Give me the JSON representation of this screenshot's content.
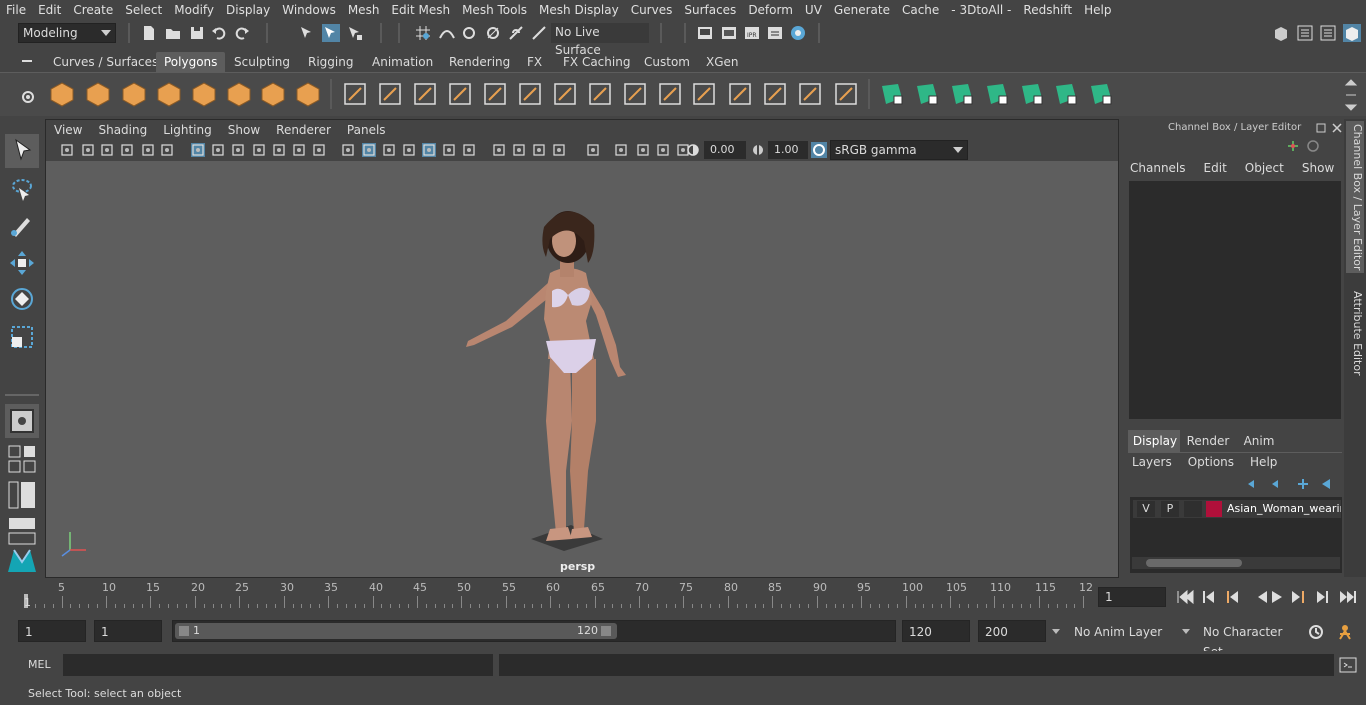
{
  "menubar": {
    "items": [
      "File",
      "Edit",
      "Create",
      "Select",
      "Modify",
      "Display",
      "Windows",
      "Mesh",
      "Edit Mesh",
      "Mesh Tools",
      "Mesh Display",
      "Curves",
      "Surfaces",
      "Deform",
      "UV",
      "Generate",
      "Cache",
      "- 3DtoAll -",
      "Redshift",
      "Help"
    ]
  },
  "statusline": {
    "mode": "Modeling",
    "live_surface": "No Live Surface"
  },
  "shelf": {
    "tabs": [
      "Curves / Surfaces",
      "Polygons",
      "Sculpting",
      "Rigging",
      "Animation",
      "Rendering",
      "FX",
      "FX Caching",
      "Custom",
      "XGen"
    ],
    "active_tab": "Polygons"
  },
  "viewport": {
    "menu": [
      "View",
      "Shading",
      "Lighting",
      "Show",
      "Renderer",
      "Panels"
    ],
    "exposure": "0.00",
    "gamma": "1.00",
    "color_space": "sRGB gamma",
    "camera_label": "persp"
  },
  "channel_box": {
    "title": "Channel Box / Layer Editor",
    "menu": [
      "Channels",
      "Edit",
      "Object",
      "Show"
    ],
    "layer_tabs": [
      "Display",
      "Render",
      "Anim"
    ],
    "active_layer_tab": "Display",
    "layer_menu": [
      "Layers",
      "Options",
      "Help"
    ],
    "layer": {
      "v": "V",
      "p": "P",
      "name": "Asian_Woman_wearin",
      "color": "#b0103a"
    }
  },
  "side_tabs": [
    "Channel Box / Layer Editor",
    "Attribute Editor"
  ],
  "timeline": {
    "ticks": [
      "5",
      "10",
      "15",
      "20",
      "25",
      "30",
      "35",
      "40",
      "45",
      "50",
      "55",
      "60",
      "65",
      "70",
      "75",
      "80",
      "85",
      "90",
      "95",
      "100",
      "105",
      "110",
      "115",
      "12"
    ],
    "current_frame_marker": "1",
    "current_frame": "1"
  },
  "range": {
    "start": "1",
    "playback_start": "1",
    "slider_start": "1",
    "slider_end": "120",
    "playback_end": "120",
    "end": "200",
    "anim_layer": "No Anim Layer",
    "character_set": "No Character Set"
  },
  "cmdline": {
    "label": "MEL"
  },
  "helpline": {
    "text": "Select Tool: select an object"
  }
}
